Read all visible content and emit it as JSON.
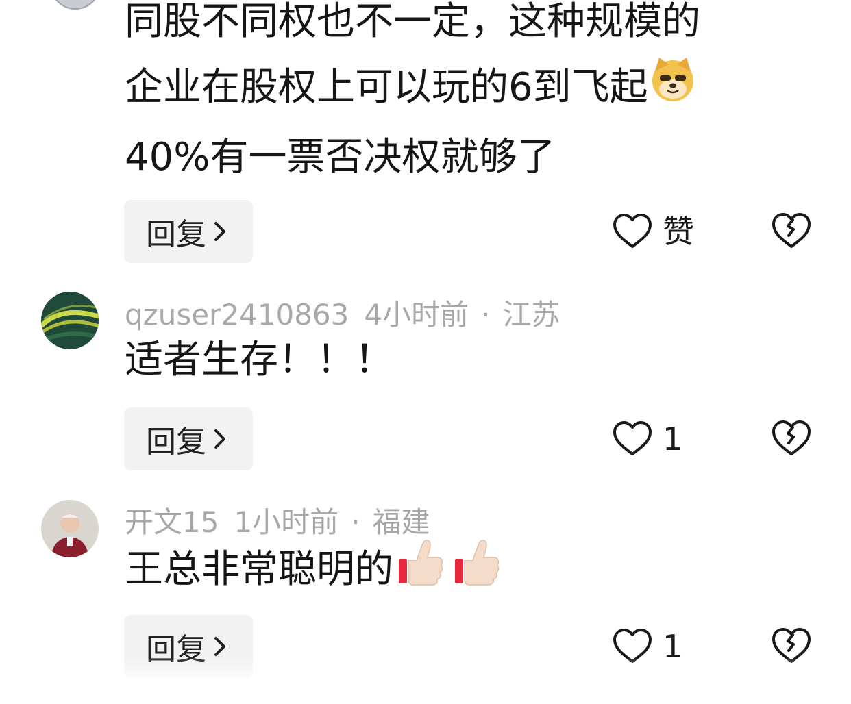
{
  "comments": [
    {
      "body_lines": [
        "同股不同权也不一定，这种规模的",
        "企业在股权上可以玩的6到飞起",
        "40%有一票否决权就够了"
      ],
      "emoji": "doge-emoji",
      "reply_label": "回复",
      "like_label": "赞",
      "likes": ""
    },
    {
      "username": "qzuser2410863",
      "time": "4小时前",
      "location": "江苏",
      "body": "适者生存！！！",
      "reply_label": "回复",
      "likes": "1"
    },
    {
      "username": "开文15",
      "time": "1小时前",
      "location": "福建",
      "body": "王总非常聪明的",
      "emoji": "thumbs-up-emoji",
      "reply_label": "回复",
      "likes": "1"
    }
  ],
  "separator": "·",
  "icons": {
    "like": "heart-outline-icon",
    "dislike": "broken-heart-icon",
    "reply_chevron": "chevron-right-icon"
  }
}
